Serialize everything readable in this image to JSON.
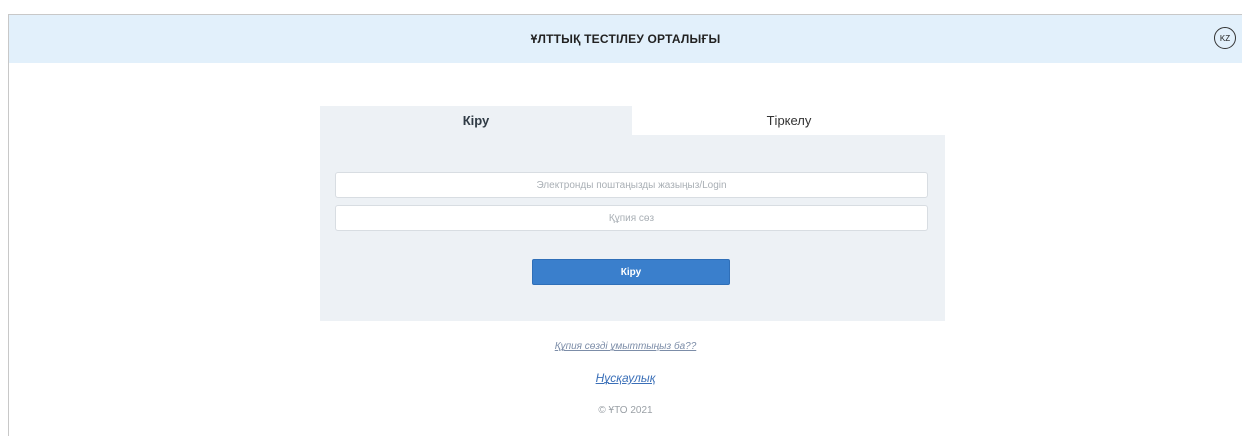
{
  "header": {
    "title": "ҰЛТТЫҚ ТЕСТІЛЕУ ОРТАЛЫҒЫ",
    "language": "KZ"
  },
  "tabs": [
    {
      "label": "Кіру",
      "active": true
    },
    {
      "label": "Тіркелу",
      "active": false
    }
  ],
  "form": {
    "email_placeholder": "Электронды поштаңызды жазыңыз/Login",
    "email_value": "",
    "password_placeholder": "Құпия сөз",
    "password_value": "",
    "submit_label": "Кіру"
  },
  "links": {
    "forgot_password": "Құпия сөзді ұмыттыңыз ба??",
    "guide": "Нұсқаулық"
  },
  "footer": {
    "copyright": "© ҰТО 2021"
  },
  "colors": {
    "header_bg": "#e2f0fb",
    "panel_bg": "#edf1f5",
    "primary_button": "#3a7fcc"
  }
}
